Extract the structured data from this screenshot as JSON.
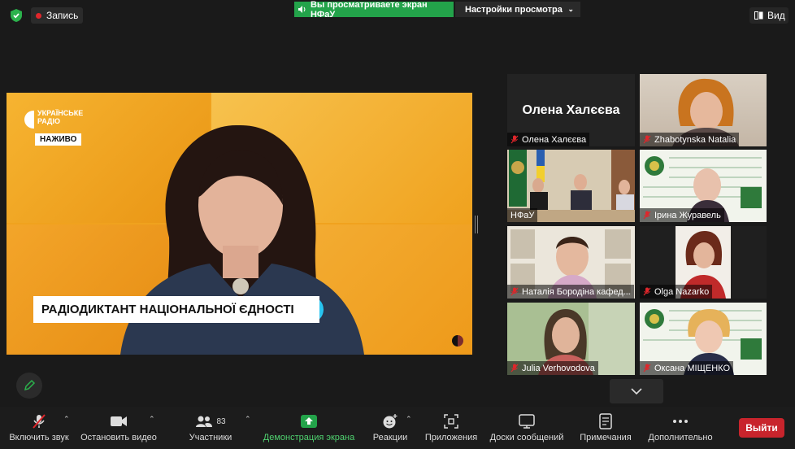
{
  "topbar": {
    "record_label": "Запись",
    "share_banner": "Вы просматриваете экран НФаУ",
    "view_options": "Настройки просмотра",
    "view_label": "Вид"
  },
  "shared_screen": {
    "station_logo": "УКРАЇНСЬКЕ РАДІО",
    "live_badge": "НАЖИВО",
    "caption": "РАДІОДИКТАНТ НАЦІОНАЛЬНОЇ ЄДНОСТІ"
  },
  "participants": [
    {
      "name": "Олена Халєєва",
      "muted": true,
      "video": false
    },
    {
      "name": "Zhabotynska Natalia",
      "muted": true,
      "video": true
    },
    {
      "name": "НФаУ",
      "muted": false,
      "video": true
    },
    {
      "name": "Ірина Журавель",
      "muted": true,
      "video": true
    },
    {
      "name": "Наталія Бородіна кафед...",
      "muted": true,
      "video": true
    },
    {
      "name": "Olga Nazarko",
      "muted": true,
      "video": true
    },
    {
      "name": "Julia Verhovodova",
      "muted": true,
      "video": true
    },
    {
      "name": "Оксана МІЩЕНКО",
      "muted": true,
      "video": true
    }
  ],
  "toolbar": {
    "unmute": "Включить звук",
    "stop_video": "Остановить видео",
    "participants": "Участники",
    "participants_count": "83",
    "share_screen": "Демонстрация экрана",
    "reactions": "Реакции",
    "apps": "Приложения",
    "whiteboards": "Доски сообщений",
    "notes": "Примечания",
    "more": "Дополнительно",
    "leave": "Выйти"
  },
  "colors": {
    "share_green": "#23a34a",
    "leave_red": "#c8242c",
    "caption_accent": "#28c4f0"
  }
}
